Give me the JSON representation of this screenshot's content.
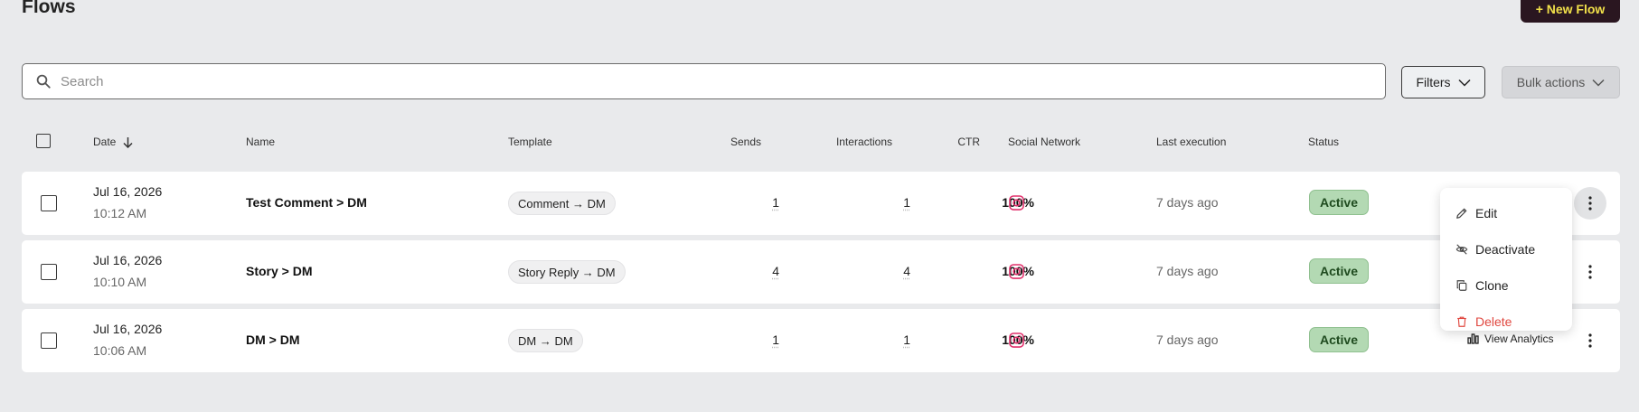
{
  "page": {
    "title": "Flows"
  },
  "toolbar": {
    "new_flow_label": "+ New Flow",
    "filters_label": "Filters",
    "bulk_actions_label": "Bulk actions"
  },
  "search": {
    "placeholder": "Search",
    "value": ""
  },
  "table": {
    "headers": {
      "date": "Date",
      "name": "Name",
      "template": "Template",
      "sends": "Sends",
      "interactions": "Interactions",
      "ctr": "CTR",
      "social_network": "Social Network",
      "last_execution": "Last execution",
      "status": "Status"
    },
    "sort": {
      "column": "date",
      "direction": "desc",
      "icon": "arrow-down-icon"
    },
    "rows": [
      {
        "date": "Jul 16, 2026",
        "time": "10:12 AM",
        "name": "Test Comment > DM",
        "template": "Comment → DM",
        "sends": "1",
        "interactions": "1",
        "ctr": "100%",
        "social_network_icon": "instagram-icon",
        "last_execution": "7 days ago",
        "status": "Active"
      },
      {
        "date": "Jul 16, 2026",
        "time": "10:10 AM",
        "name": "Story > DM",
        "template": "Story Reply → DM",
        "sends": "4",
        "interactions": "4",
        "ctr": "100%",
        "social_network_icon": "instagram-icon",
        "last_execution": "7 days ago",
        "status": "Active"
      },
      {
        "date": "Jul 16, 2026",
        "time": "10:06 AM",
        "name": "DM > DM",
        "template": "DM → DM",
        "sends": "1",
        "interactions": "1",
        "ctr": "100%",
        "social_network_icon": "instagram-icon",
        "last_execution": "7 days ago",
        "status": "Active",
        "view_analytics_label": "View Analytics"
      }
    ]
  },
  "row_menu": {
    "items": [
      {
        "label": "Edit",
        "icon": "pencil-icon"
      },
      {
        "label": "Deactivate",
        "icon": "eye-off-icon"
      },
      {
        "label": "Clone",
        "icon": "copy-icon"
      },
      {
        "label": "Delete",
        "icon": "trash-icon"
      }
    ]
  },
  "colors": {
    "accent_button_bg": "#2a1620",
    "accent_button_text": "#f1e04a",
    "status_active_bg": "#b3d9b3",
    "instagram": "#e1306c",
    "danger": "#e0473f"
  }
}
